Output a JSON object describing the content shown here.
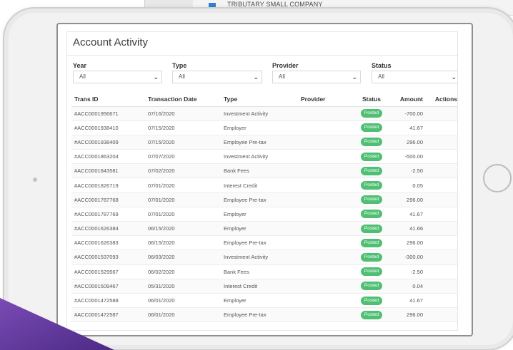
{
  "background_app": {
    "fund_name": "TRIBUTARY SMALL COMPANY"
  },
  "colors": {
    "posted_badge": "#4fbf73",
    "purple_accent": "#6b3fa0"
  },
  "account_activity": {
    "title": "Account Activity",
    "filters": [
      {
        "label": "Year",
        "value": "All"
      },
      {
        "label": "Type",
        "value": "All"
      },
      {
        "label": "Provider",
        "value": "All"
      },
      {
        "label": "Status",
        "value": "All"
      }
    ],
    "columns": [
      "Trans ID",
      "Transaction Date",
      "Type",
      "Provider",
      "Status",
      "Amount",
      "Actions"
    ],
    "rows": [
      {
        "id": "#ACC0001956671",
        "date": "07/16/2020",
        "type": "Investment Activity",
        "provider": "",
        "status": "Posted",
        "amount": "-700.00"
      },
      {
        "id": "#ACC0001938410",
        "date": "07/15/2020",
        "type": "Employer",
        "provider": "",
        "status": "Posted",
        "amount": "41.67"
      },
      {
        "id": "#ACC0001938409",
        "date": "07/15/2020",
        "type": "Employee Pre-tax",
        "provider": "",
        "status": "Posted",
        "amount": "296.00"
      },
      {
        "id": "#ACC0001863204",
        "date": "07/07/2020",
        "type": "Investment Activity",
        "provider": "",
        "status": "Posted",
        "amount": "-500.00"
      },
      {
        "id": "#ACC0001843581",
        "date": "07/02/2020",
        "type": "Bank Fees",
        "provider": "",
        "status": "Posted",
        "amount": "-2.50"
      },
      {
        "id": "#ACC0001826719",
        "date": "07/01/2020",
        "type": "Interest Credit",
        "provider": "",
        "status": "Posted",
        "amount": "0.05"
      },
      {
        "id": "#ACC0001787768",
        "date": "07/01/2020",
        "type": "Employee Pre-tax",
        "provider": "",
        "status": "Posted",
        "amount": "296.00"
      },
      {
        "id": "#ACC0001787769",
        "date": "07/01/2020",
        "type": "Employer",
        "provider": "",
        "status": "Posted",
        "amount": "41.67"
      },
      {
        "id": "#ACC0001626384",
        "date": "06/15/2020",
        "type": "Employer",
        "provider": "",
        "status": "Posted",
        "amount": "41.66"
      },
      {
        "id": "#ACC0001626383",
        "date": "06/15/2020",
        "type": "Employee Pre-tax",
        "provider": "",
        "status": "Posted",
        "amount": "296.00"
      },
      {
        "id": "#ACC0001537093",
        "date": "06/03/2020",
        "type": "Investment Activity",
        "provider": "",
        "status": "Posted",
        "amount": "-300.00"
      },
      {
        "id": "#ACC0001529567",
        "date": "06/02/2020",
        "type": "Bank Fees",
        "provider": "",
        "status": "Posted",
        "amount": "-2.50"
      },
      {
        "id": "#ACC0001509467",
        "date": "05/31/2020",
        "type": "Interest Credit",
        "provider": "",
        "status": "Posted",
        "amount": "0.04"
      },
      {
        "id": "#ACC0001472588",
        "date": "06/01/2020",
        "type": "Employer",
        "provider": "",
        "status": "Posted",
        "amount": "41.67"
      },
      {
        "id": "#ACC0001472587",
        "date": "06/01/2020",
        "type": "Employee Pre-tax",
        "provider": "",
        "status": "Posted",
        "amount": "296.00"
      }
    ]
  }
}
